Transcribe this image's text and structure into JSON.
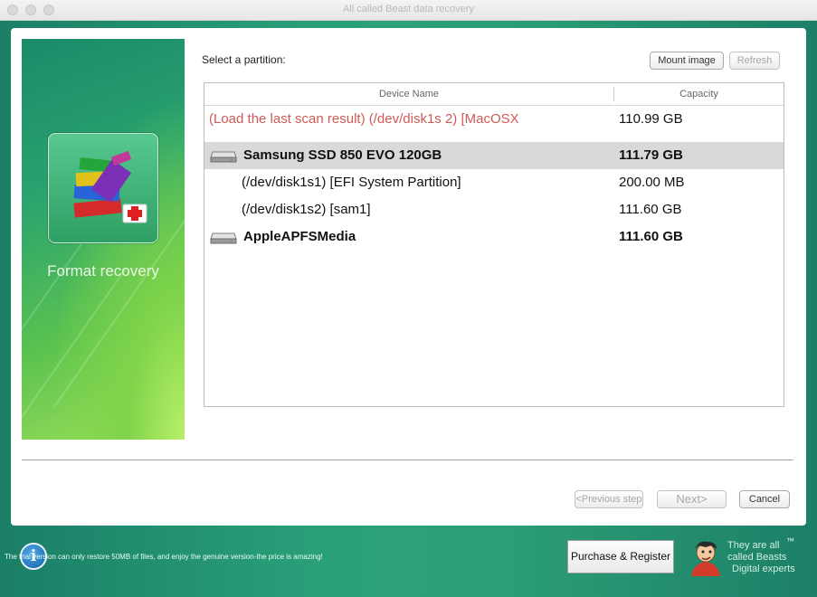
{
  "window": {
    "title": "All called Beast data recovery"
  },
  "sidebar": {
    "mode_label": "Format recovery"
  },
  "content": {
    "select_label": "Select a partition:",
    "mount_button": "Mount image",
    "refresh_button": "Refresh"
  },
  "table": {
    "col_name": "Device Name",
    "col_capacity": "Capacity",
    "rows": [
      {
        "name": "(Load the last scan result) (/dev/disk1s 2) [MacOSX",
        "capacity": "110.99 GB"
      },
      {
        "name": "Samsung SSD 850 EVO 120GB",
        "capacity": "111.79 GB"
      },
      {
        "name": "(/dev/disk1s1) [EFI System Partition]",
        "capacity": "200.00 MB"
      },
      {
        "name": "(/dev/disk1s2) [sam1]",
        "capacity": "111.60 GB"
      },
      {
        "name": "AppleAPFSMedia",
        "capacity": "111.60 GB"
      }
    ]
  },
  "nav": {
    "previous": "<Previous step",
    "next": "Next>",
    "cancel": "Cancel"
  },
  "footer": {
    "notice": "The trial version can only restore 50MB of files, and enjoy the genuine version-the price is amazing!",
    "purchase": "Purchase & Register",
    "tagline_1": "They are all",
    "tagline_2": "called Beasts",
    "tagline_3": "Digital experts",
    "trademark": "™"
  },
  "colors": {
    "accent_green": "#2aa07a",
    "scan_row_red": "#cf5a56",
    "selected_row": "#d9d9d9"
  }
}
